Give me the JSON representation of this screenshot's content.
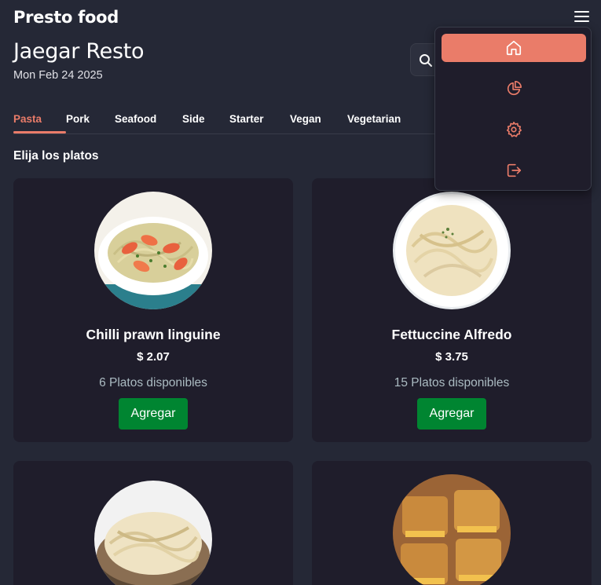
{
  "app": {
    "brand": "Presto food"
  },
  "header": {
    "restaurant": "Jaegar Resto",
    "date": "Mon Feb 24 2025"
  },
  "tabs": [
    {
      "label": "Pasta",
      "active": true
    },
    {
      "label": "Pork"
    },
    {
      "label": "Seafood"
    },
    {
      "label": "Side"
    },
    {
      "label": "Starter"
    },
    {
      "label": "Vegan"
    },
    {
      "label": "Vegetarian"
    }
  ],
  "section": {
    "title": "Elija los platos"
  },
  "dishes": [
    {
      "name": "Chilli prawn linguine",
      "price": "$ 2.07",
      "availability": "6 Platos disponibles",
      "button": "Agregar"
    },
    {
      "name": "Fettuccine Alfredo",
      "price": "$ 3.75",
      "availability": "15 Platos disponibles",
      "button": "Agregar"
    },
    {
      "name": "",
      "price": "",
      "availability": "",
      "button": ""
    },
    {
      "name": "",
      "price": "",
      "availability": "",
      "button": ""
    }
  ],
  "menu": {
    "items": [
      {
        "icon": "home-icon",
        "active": true
      },
      {
        "icon": "pie-chart-icon"
      },
      {
        "icon": "gear-icon"
      },
      {
        "icon": "logout-icon"
      }
    ]
  },
  "colors": {
    "accent": "#ea7c69",
    "background": "#252836",
    "card": "#1f1d2b",
    "button": "#008531"
  }
}
